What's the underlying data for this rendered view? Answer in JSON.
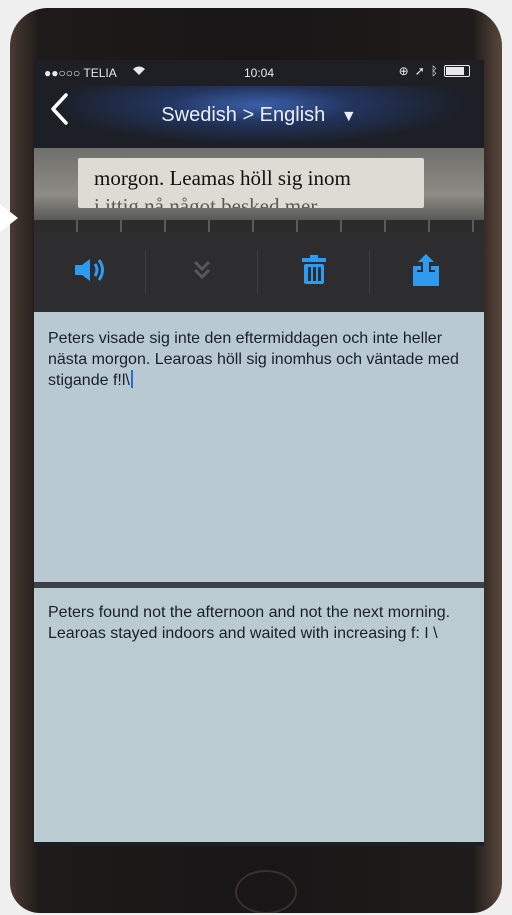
{
  "status": {
    "carrier": "●●○○○ TELIA",
    "time": "10:04"
  },
  "nav": {
    "title": "Swedish > English",
    "caret": "▼"
  },
  "camera": {
    "line1": "morgon. Leamas höll sig inom",
    "line2": "i ittig   nå något besked  mer"
  },
  "toolbar": {
    "icons": [
      "speaker-icon",
      "chevron-double-down-icon",
      "trash-icon",
      "share-icon"
    ],
    "accent": "#2e9bf0"
  },
  "source_text": "Peters visade sig inte den eftermiddagen och inte heller nästa morgon. Learoas höll sig inomhus och väntade med stigande f!l\\",
  "translated_text": "Peters found not the afternoon and not the next morning. Learoas stayed indoors and waited with increasing f: I \\"
}
